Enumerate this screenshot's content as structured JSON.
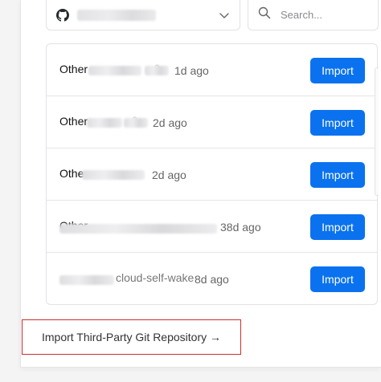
{
  "scope_select": {
    "icon": "github-icon",
    "selected_value_redacted": true
  },
  "search": {
    "placeholder": "Search..."
  },
  "repositories": [
    {
      "name_prefix": "Other",
      "time": "1d ago",
      "import_label": "Import"
    },
    {
      "name_prefix": "Other",
      "time": "2d ago",
      "import_label": "Import"
    },
    {
      "name_prefix": "Othe",
      "time": "2d ago",
      "import_label": "Import"
    },
    {
      "name_prefix": "Other",
      "time": "38d ago",
      "import_label": "Import"
    },
    {
      "name_prefix": "",
      "visible_suffix": "cloud-self-wake",
      "time": "8d ago",
      "import_label": "Import"
    }
  ],
  "third_party": {
    "label": "Import Third-Party Git Repository →"
  },
  "colors": {
    "accent": "#0a72ef",
    "highlight_border": "#c9302c"
  }
}
